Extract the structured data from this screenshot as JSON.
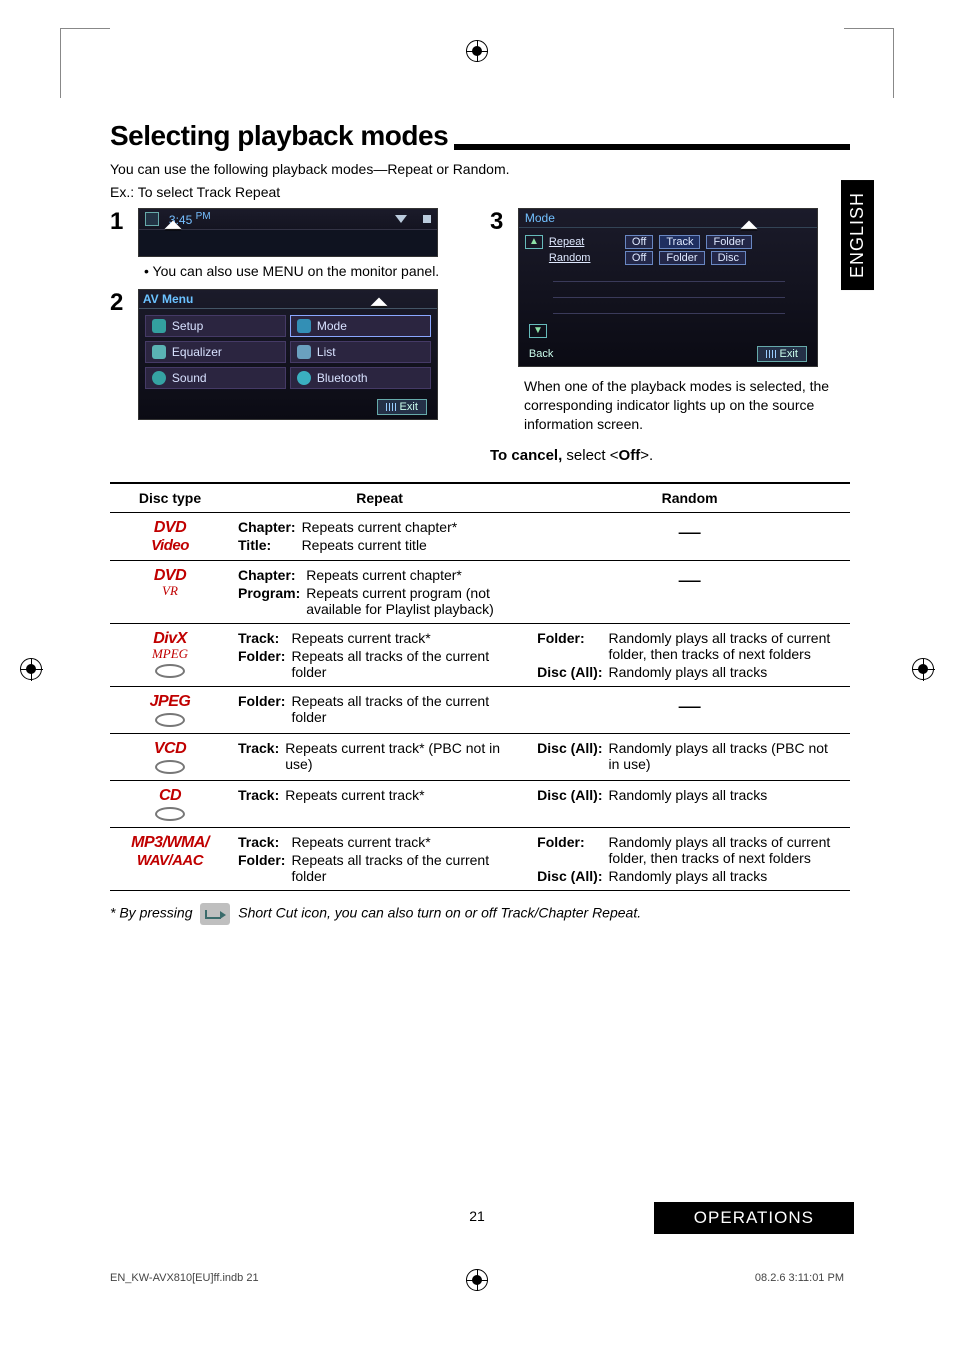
{
  "tab": "ENGLISH",
  "title": "Selecting playback modes",
  "intro": "You can use the following playback modes—Repeat or Random.",
  "example": "Ex.: To select Track Repeat",
  "steps": {
    "s1": {
      "num": "1",
      "time": "3:45",
      "ampm": "PM",
      "note": "You can also use MENU on the monitor panel."
    },
    "s2": {
      "num": "2",
      "menuTitle": "AV Menu",
      "items": {
        "setup": "Setup",
        "mode": "Mode",
        "equalizer": "Equalizer",
        "list": "List",
        "sound": "Sound",
        "bluetooth": "Bluetooth"
      },
      "exit": "Exit"
    },
    "s3": {
      "num": "3",
      "title": "Mode",
      "rows": {
        "repeat": {
          "label": "Repeat",
          "opts": [
            "Off",
            "Track",
            "Folder"
          ]
        },
        "random": {
          "label": "Random",
          "opts": [
            "Off",
            "Folder",
            "Disc"
          ]
        }
      },
      "back": "Back",
      "exit": "Exit",
      "desc": "When one of the playback modes is selected, the corresponding indicator lights up on the source information screen."
    }
  },
  "cancel": {
    "prefix": "To cancel,",
    "rest": " select <",
    "off": "Off",
    "end": ">."
  },
  "table": {
    "headers": {
      "disc": "Disc type",
      "repeat": "Repeat",
      "random": "Random"
    },
    "rows": [
      {
        "disc": {
          "l1": "DVD",
          "l2": "Video"
        },
        "repeat": [
          [
            "Chapter:",
            "Repeats current chapter*"
          ],
          [
            "Title:",
            "Repeats current title"
          ]
        ],
        "random": "—"
      },
      {
        "disc": {
          "l1": "DVD",
          "l2": "VR"
        },
        "repeat": [
          [
            "Chapter:",
            "Repeats current chapter*"
          ],
          [
            "Program:",
            "Repeats current program (not available for Playlist playback)"
          ]
        ],
        "random": "—"
      },
      {
        "disc": {
          "l1": "DivX",
          "l2": "MPEG",
          "disc": true
        },
        "repeat": [
          [
            "Track:",
            "Repeats current track*"
          ],
          [
            "Folder:",
            "Repeats all tracks of the current folder"
          ]
        ],
        "randomDefs": [
          [
            "Folder:",
            "Randomly plays all tracks of current folder, then tracks of next folders"
          ],
          [
            "Disc (All):",
            "Randomly plays all tracks"
          ]
        ]
      },
      {
        "disc": {
          "l1": "JPEG",
          "disc": true
        },
        "repeat": [
          [
            "Folder:",
            "Repeats all tracks of the current folder"
          ]
        ],
        "random": "—"
      },
      {
        "disc": {
          "l1": "VCD",
          "disc": true
        },
        "repeat": [
          [
            "Track:",
            "Repeats current track* (PBC not in use)"
          ]
        ],
        "randomDefs": [
          [
            "Disc (All):",
            "Randomly plays all tracks (PBC not in use)"
          ]
        ]
      },
      {
        "disc": {
          "l1": "CD",
          "disc": true
        },
        "repeat": [
          [
            "Track:",
            "Repeats current track*"
          ]
        ],
        "randomDefs": [
          [
            "Disc (All):",
            "Randomly plays all tracks"
          ]
        ]
      },
      {
        "disc": {
          "l1": "MP3/WMA/",
          "l2": "WAV/AAC"
        },
        "repeat": [
          [
            "Track:",
            "Repeats current track*"
          ],
          [
            "Folder:",
            "Repeats all tracks of the current folder"
          ]
        ],
        "randomDefs": [
          [
            "Folder:",
            "Randomly plays all tracks of current folder, then tracks of next folders"
          ],
          [
            "Disc (All):",
            "Randomly plays all tracks"
          ]
        ]
      }
    ]
  },
  "footnote": {
    "pre": "*    By pressing ",
    "post": " Short Cut icon, you can also turn on or off Track/Chapter Repeat."
  },
  "pageNum": "21",
  "ops": "OPERATIONS",
  "footer": {
    "left": "EN_KW-AVX810[EU]ff.indb   21",
    "right": "08.2.6   3:11:01 PM"
  }
}
